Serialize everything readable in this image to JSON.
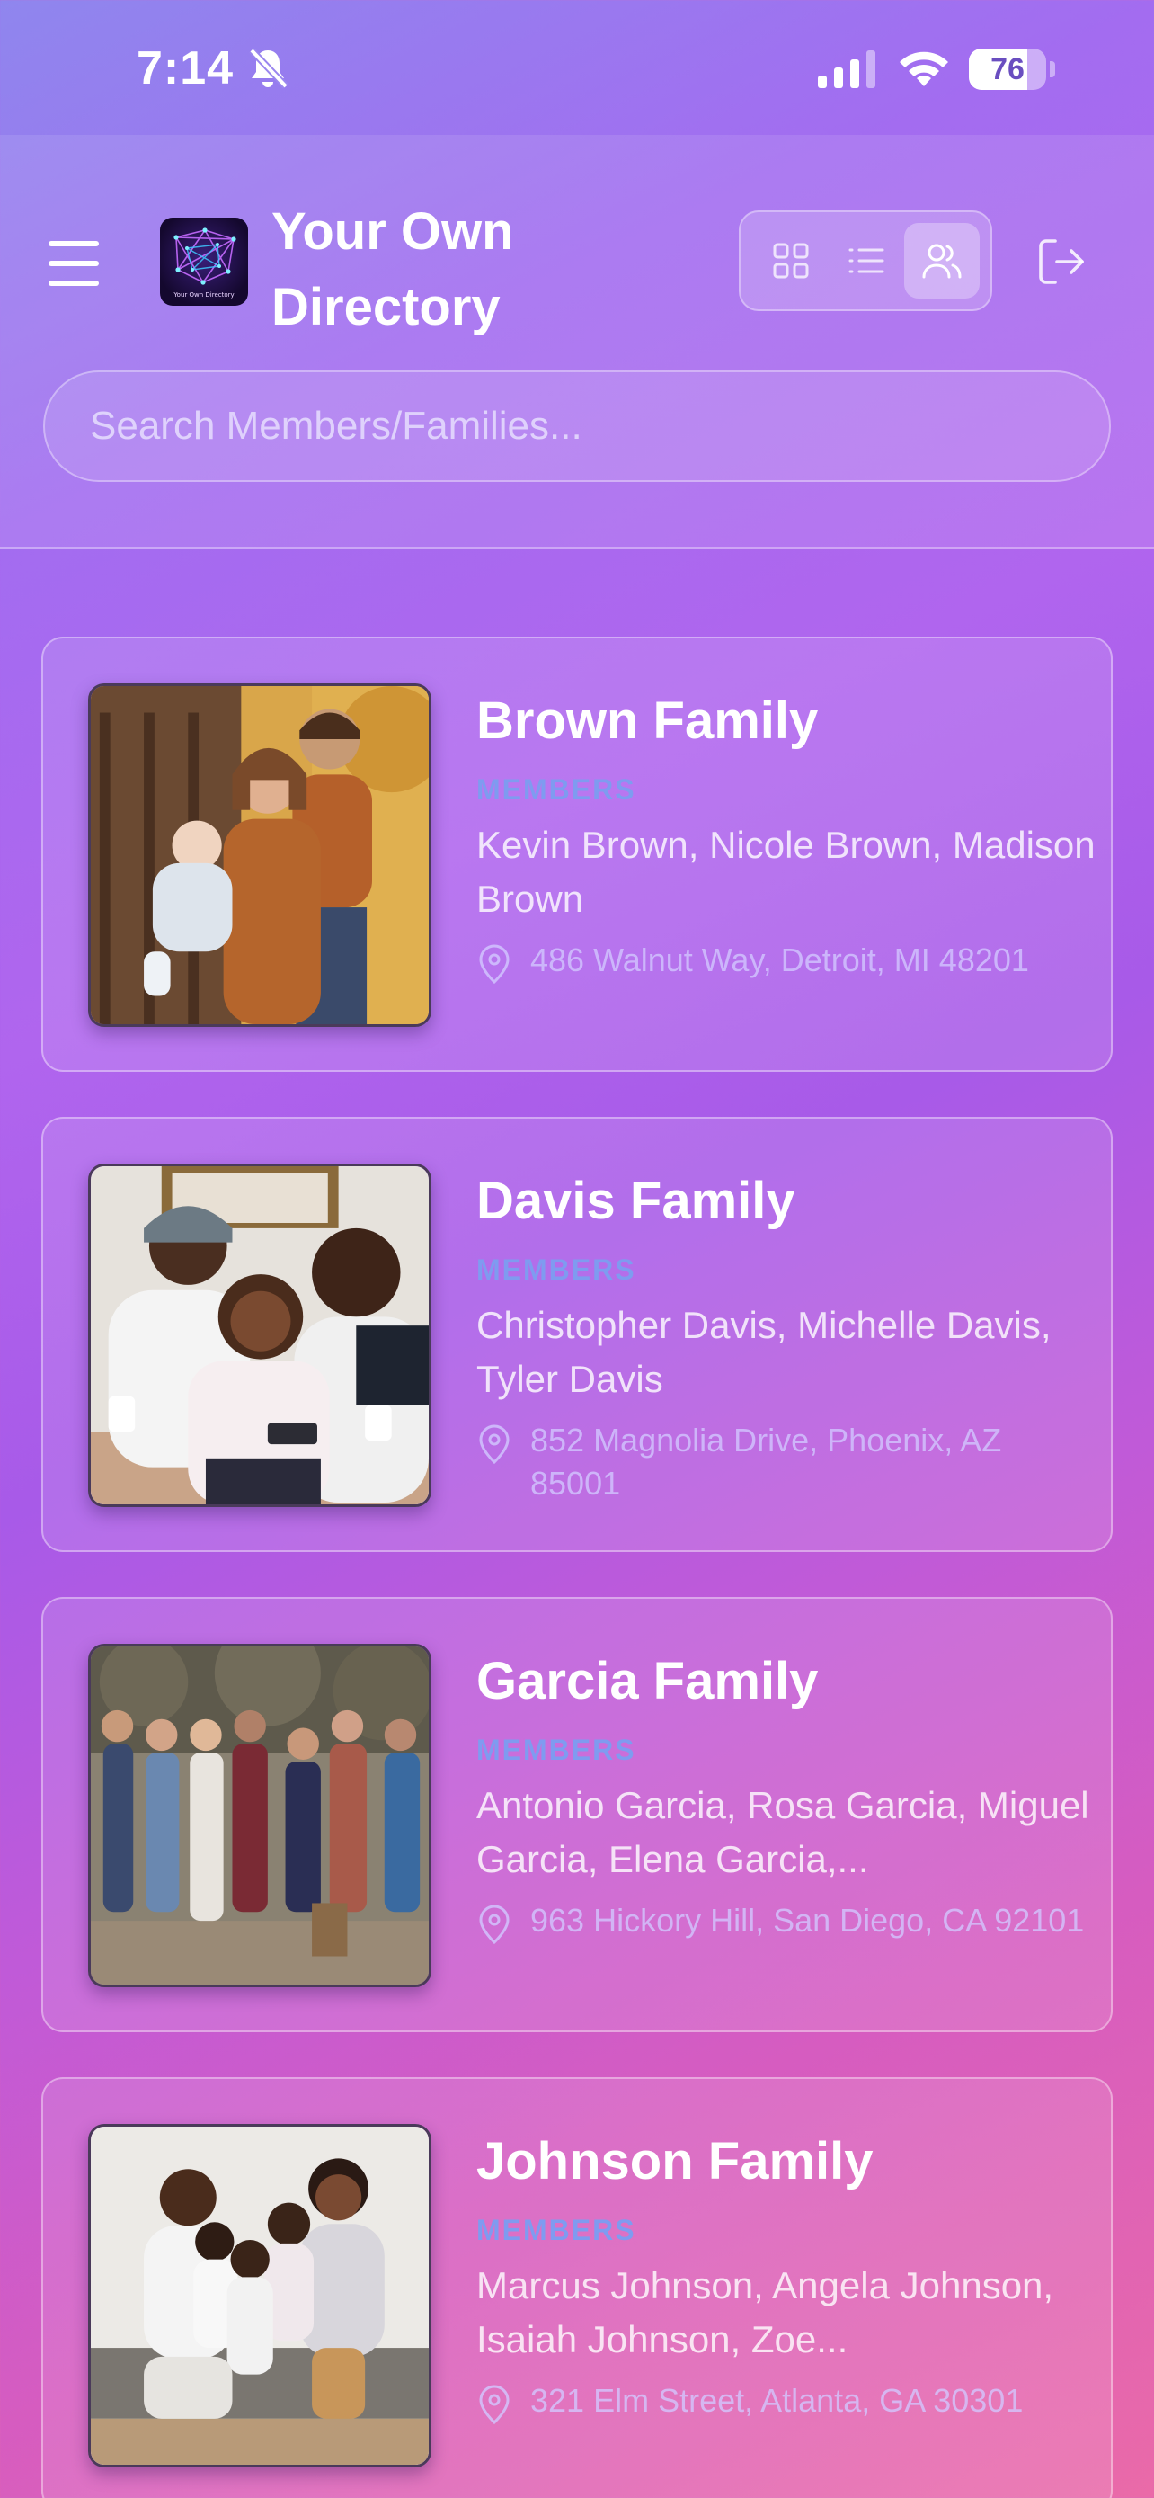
{
  "status": {
    "time": "7:14",
    "battery": "76",
    "battery_level": 0.76
  },
  "app": {
    "title": "Your Own Directory",
    "logo_text": "Your Own Directory"
  },
  "search": {
    "placeholder": "Search Members/Families..."
  },
  "view_modes": [
    "grid-icon",
    "list-icon",
    "families-icon"
  ],
  "active_view": "families-icon",
  "families": [
    {
      "name": "Brown Family",
      "members_label": "MEMBERS",
      "members": "Kevin Brown, Nicole Brown, Madison Brown",
      "address": "486 Walnut Way, Detroit, MI 48201"
    },
    {
      "name": "Davis Family",
      "members_label": "MEMBERS",
      "members": "Christopher Davis, Michelle Davis, Tyler Davis",
      "address": "852 Magnolia Drive, Phoenix, AZ 85001"
    },
    {
      "name": "Garcia Family",
      "members_label": "MEMBERS",
      "members": "Antonio Garcia, Rosa Garcia, Miguel Garcia, Elena Garcia,...",
      "address": "963 Hickory Hill, San Diego, CA 92101"
    },
    {
      "name": "Johnson Family",
      "members_label": "MEMBERS",
      "members": "Marcus Johnson, Angela Johnson, Isaiah Johnson, Zoe...",
      "address": "321 Elm Street, Atlanta, GA 30301"
    }
  ],
  "colors": {
    "members_label": "#7f9bf0",
    "accent": "#a36cf0"
  }
}
